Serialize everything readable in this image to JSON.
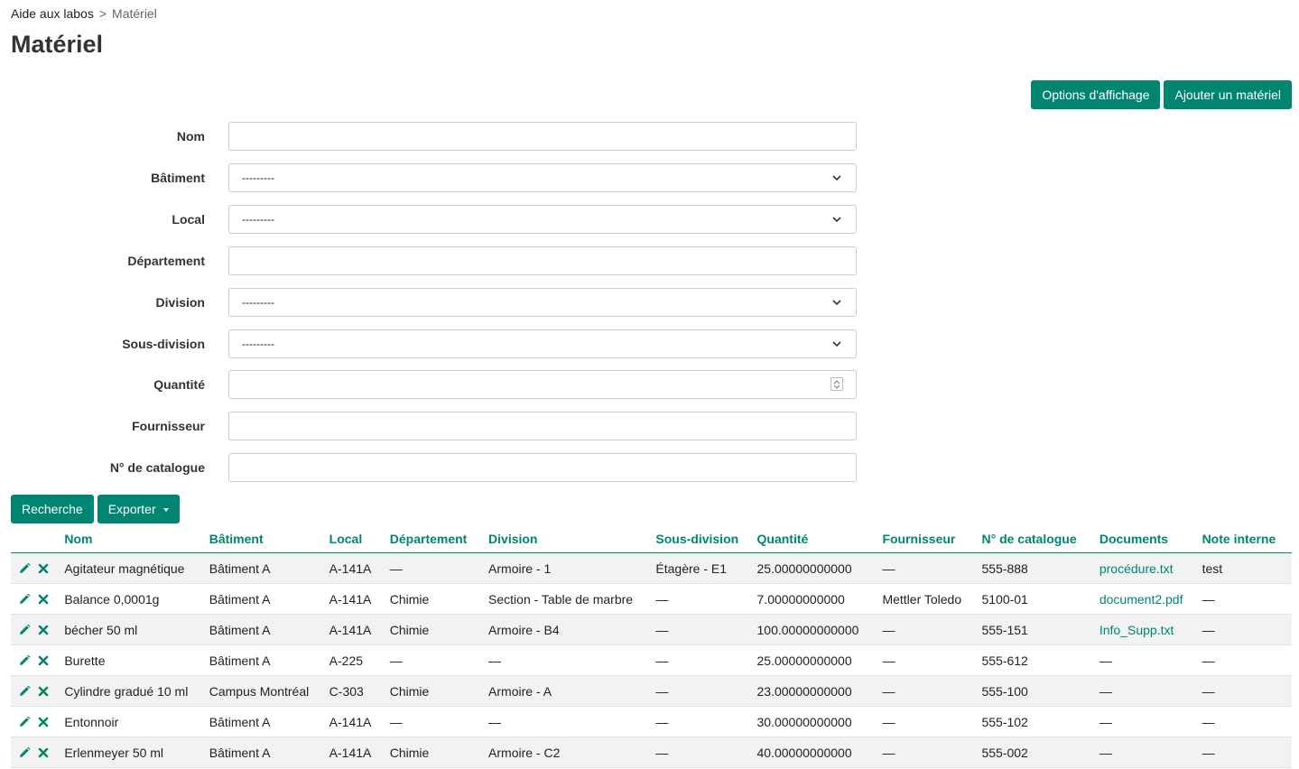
{
  "breadcrumb": {
    "home": "Aide aux labos",
    "separator": ">",
    "current": "Matériel"
  },
  "page": {
    "title": "Matériel"
  },
  "actions": {
    "display_options": "Options d'affichage",
    "add_item": "Ajouter un matériel"
  },
  "form": {
    "nom": {
      "label": "Nom",
      "value": ""
    },
    "batiment": {
      "label": "Bâtiment",
      "value": "---------"
    },
    "local": {
      "label": "Local",
      "value": "---------"
    },
    "departement": {
      "label": "Département",
      "value": ""
    },
    "division": {
      "label": "Division",
      "value": "---------"
    },
    "sous_division": {
      "label": "Sous-division",
      "value": "---------"
    },
    "quantite": {
      "label": "Quantité",
      "value": ""
    },
    "fournisseur": {
      "label": "Fournisseur",
      "value": ""
    },
    "catalogue": {
      "label": "N° de catalogue",
      "value": ""
    }
  },
  "search": {
    "search_label": "Recherche",
    "export_label": "Exporter"
  },
  "table": {
    "columns": [
      "Nom",
      "Bâtiment",
      "Local",
      "Département",
      "Division",
      "Sous-division",
      "Quantité",
      "Fournisseur",
      "N° de catalogue",
      "Documents",
      "Note interne"
    ],
    "rows": [
      [
        "Agitateur magnétique",
        "Bâtiment A",
        "A-141A",
        "—",
        "Armoire - 1",
        "Étagère - E1",
        "25.00000000000",
        "—",
        "555-888",
        "procédure.txt",
        "test"
      ],
      [
        "Balance 0,0001g",
        "Bâtiment A",
        "A-141A",
        "Chimie",
        "Section - Table de marbre",
        "—",
        "7.00000000000",
        "Mettler Toledo",
        "5100-01",
        "document2.pdf",
        "—"
      ],
      [
        "bécher 50 ml",
        "Bâtiment A",
        "A-141A",
        "Chimie",
        "Armoire - B4",
        "—",
        "100.00000000000",
        "—",
        "555-151",
        "Info_Supp.txt",
        "—"
      ],
      [
        "Burette",
        "Bâtiment A",
        "A-225",
        "—",
        "—",
        "—",
        "25.00000000000",
        "—",
        "555-612",
        "—",
        "—"
      ],
      [
        "Cylindre gradué 10 ml",
        "Campus Montréal",
        "C-303",
        "Chimie",
        "Armoire - A",
        "—",
        "23.00000000000",
        "—",
        "555-100",
        "—",
        "—"
      ],
      [
        "Entonnoir",
        "Bâtiment A",
        "A-141A",
        "—",
        "—",
        "—",
        "30.00000000000",
        "—",
        "555-102",
        "—",
        "—"
      ],
      [
        "Erlenmeyer 50 ml",
        "Bâtiment A",
        "A-141A",
        "Chimie",
        "Armoire - C2",
        "—",
        "40.00000000000",
        "—",
        "555-002",
        "—",
        "—"
      ]
    ]
  },
  "colors": {
    "accent": "#008571",
    "row_alt": "#f2f2f2"
  },
  "icons": {
    "edit": "pencil-icon",
    "delete": "close-icon",
    "select": "chevron-down-icon"
  }
}
